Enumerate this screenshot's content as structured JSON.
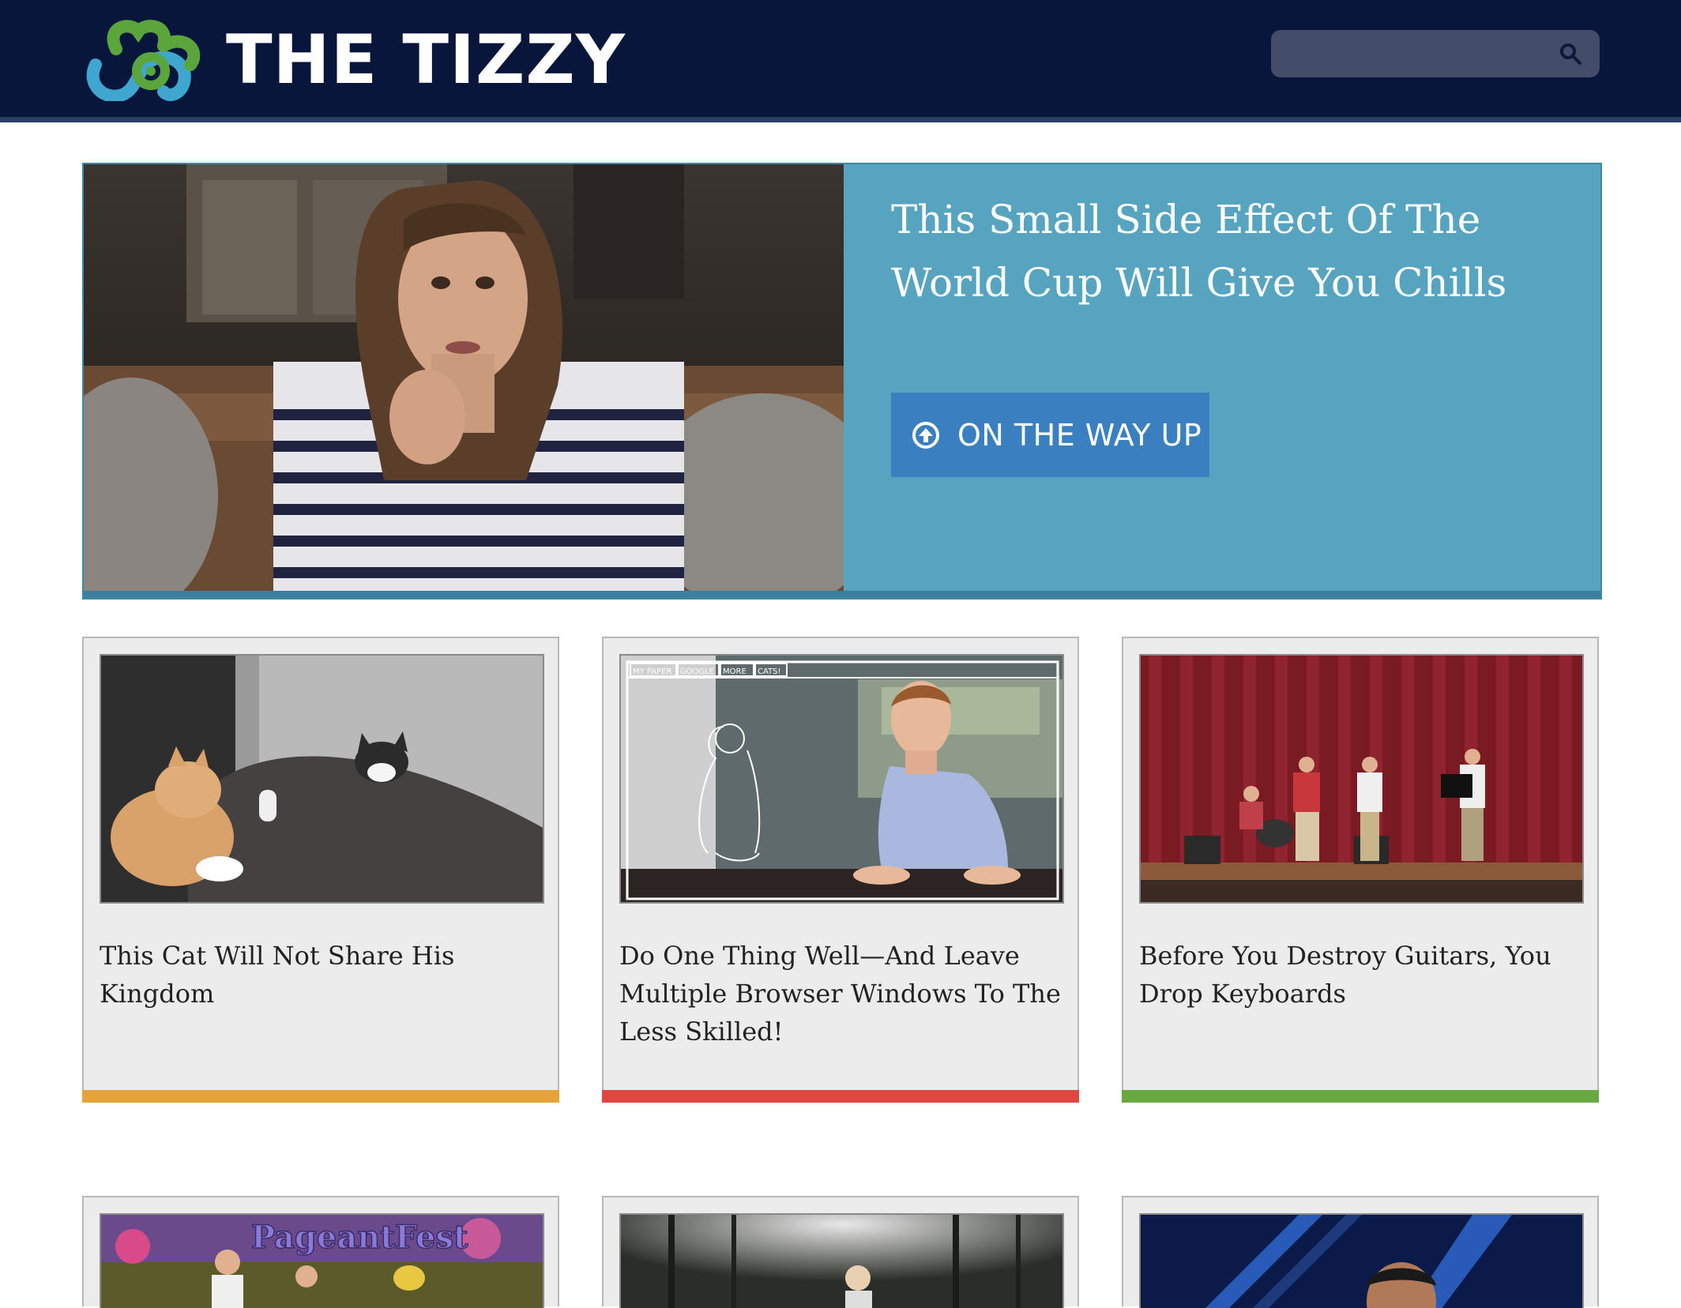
{
  "header": {
    "brand": "THE TIZZY",
    "search": {
      "value": "",
      "placeholder": ""
    }
  },
  "hero": {
    "title": "This Small Side Effect Of The World Cup Will Give You Chills",
    "button_label": "ON THE WAY UP"
  },
  "cards": [
    {
      "title": "This Cat Will Not Share His Kingdom",
      "accent": "#e5a33a"
    },
    {
      "title": "Do One Thing Well—And Leave Multiple Browser Windows To The Less Skilled!",
      "accent": "#e0463f"
    },
    {
      "title": "Before You Destroy Guitars, You Drop Keyboards",
      "accent": "#6aa842"
    }
  ],
  "thumb_text": {
    "browser_tabs": [
      "MY PAPER",
      "GOOGLE",
      "MORE",
      "CATS!"
    ],
    "pageant_sign": "PageantFest"
  },
  "colors": {
    "header_bg": "#07163a",
    "hero_bg": "#57a4c1",
    "hero_button": "#3a80c1",
    "logo_green": "#5aa63d",
    "logo_blue": "#3fa6cf"
  }
}
